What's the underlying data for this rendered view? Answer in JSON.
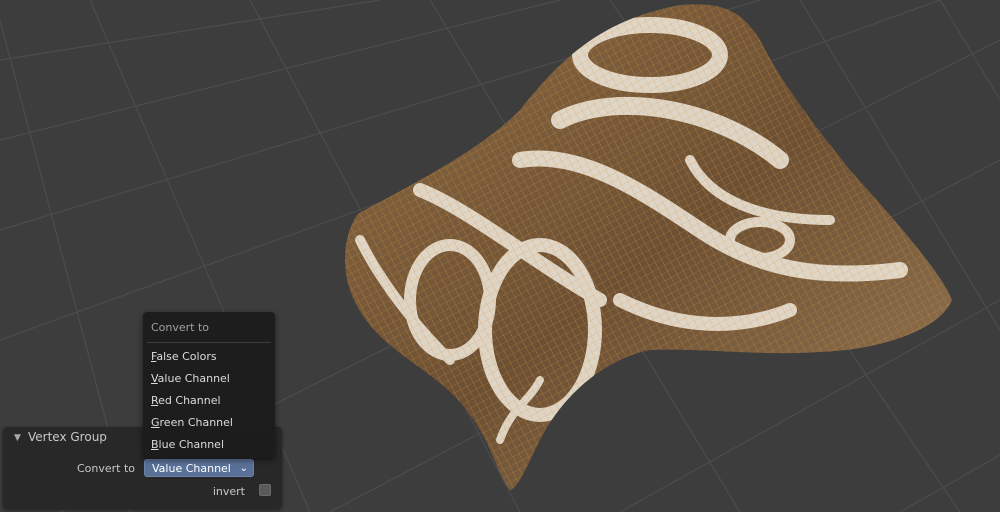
{
  "redo_panel": {
    "title": "Vertex Group",
    "collapse_icon": "▼",
    "convert_label": "Convert to",
    "convert_value": "Value Channel",
    "chevron_icon": "⌄",
    "invert_label": "invert",
    "invert_checked": false
  },
  "dropdown": {
    "title": "Convert to",
    "items": [
      {
        "first": "F",
        "rest": "alse Colors"
      },
      {
        "first": "V",
        "rest": "alue Channel"
      },
      {
        "first": "R",
        "rest": "ed Channel"
      },
      {
        "first": "G",
        "rest": "reen Channel"
      },
      {
        "first": "B",
        "rest": "lue Channel"
      }
    ]
  },
  "colors": {
    "viewport_bg": "#3d3d3d",
    "grid_line": "#4a4a4a",
    "mesh_wire": "#d39a3a",
    "mesh_dark": "#5a4126",
    "mesh_light": "#e9e2d6",
    "accent_select": "#597198"
  }
}
